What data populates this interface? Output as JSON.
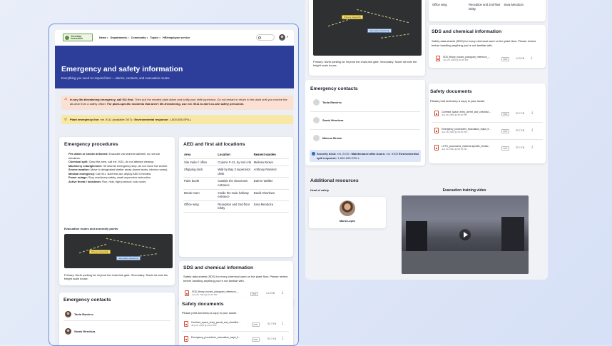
{
  "app": {
    "logo_text": "Vendzlay Industries",
    "nav": [
      "News",
      "Departments",
      "Community",
      "Topics",
      "HR/employee service"
    ],
    "search_placeholder": ""
  },
  "hero": {
    "title": "Emergency and safety information",
    "subtitle": "Everything you need to respond fast — alarms, contacts, and evacuation routes."
  },
  "alert": {
    "lead": "In any life-threatening emergency, call 911 first.",
    "body": "Then pull the nearest plant alarm and notify your shift supervisor. Do not restart or return to the plant until you receive the all-clear from a safety officer.",
    "bold_tail": "For plant-specific incidents that aren’t life-threatening, use ext. 9311 to alert on-site safety personnel."
  },
  "hotline": {
    "label": "Plant emergency line:",
    "value": "ext. 9111 (available 24/7)",
    "sep": " • ",
    "env_label": "Environmental response:",
    "env_value": "1-800-555-SPILL"
  },
  "procedures": {
    "title": "Emergency procedures",
    "items": [
      {
        "term": "Fire alarm or smoke detected:",
        "text": "Evacuate via nearest stairwell, do not use elevators."
      },
      {
        "term": "Chemical spill:",
        "text": "Clear the area, call ext. 9111, do not attempt cleanup."
      },
      {
        "term": "Machinery entanglement:",
        "text": "Hit nearest emergency stop, do not move the worker."
      },
      {
        "term": "Severe weather:",
        "text": "Move to designated shelter areas (lower levels, interior rooms)."
      },
      {
        "term": "Medical emergency:",
        "text": "Call 911, start first aid, deploy AED if needed."
      },
      {
        "term": "Power outage:",
        "text": "Stop machinery safely, await supervisor instruction."
      },
      {
        "term": "Active threat / lockdown:",
        "text": "Run, hide, fight protocol; lock doors."
      }
    ],
    "routes_title": "Evacuation routes and assembly points",
    "map_labels": {
      "primary": "Primary Assembly",
      "secondary": "Secondary Assembly"
    },
    "caption": "Primary: North parking lot, beyond the chain-link gate. Secondary: South lot near the freight scale house."
  },
  "aed": {
    "title": "AED and first aid locations",
    "columns": [
      "Area",
      "Location",
      "Nearest warden"
    ],
    "rows": [
      [
        "Site trailer / office",
        "Column F-12, by tool crib",
        "Melissa Brown"
      ],
      [
        "Shipping dock",
        "Wall by Bay 3 supervisor desk",
        "Anthony Ramirez"
      ],
      [
        "Paint booth",
        "Outside the cleanroom entrance",
        "Darren Walker"
      ],
      [
        "Break room",
        "Inside the main hallway entrance",
        "David Okonkwo"
      ],
      [
        "Office wing",
        "Reception and 2nd-floor lobby",
        "Sara Mendoza"
      ]
    ]
  },
  "sds": {
    "title": "SDS and chemical information",
    "text": "Safety data sheets (SDS) for every chemical used on the plant floor. Please review before handling anything you’re not familiar with.",
    "file": {
      "name": "SDS_library_hazard_pictogram_reference_...",
      "date": "July 20, 2024 @ 09:15 PM",
      "type": "PDF",
      "size": "14.3 KB"
    }
  },
  "contacts": {
    "title": "Emergency contacts",
    "people": [
      "Tania Ramirez",
      "Sarah Mendoza",
      "Marcus Brown"
    ]
  },
  "security": {
    "label": "Security desk:",
    "value": "ext. 2100",
    "sep": " • ",
    "maint_label": "Maintenance after-hours:",
    "maint_value": "ext. 9300",
    "env_label": "Environmental spill response:",
    "env_value": "1-800-555-SPILL"
  },
  "documents": {
    "title": "Safety documents",
    "intro": "Please print and keep a copy in your locker.",
    "files": [
      {
        "name": "Confined_space_entry_permit_and_checklist....",
        "date": "July 20, 2024 @ 09:15 PM",
        "type": "PDF",
        "size": "93.7 KB"
      },
      {
        "name": "Emergency_procedures_evacuation_maps_fl...",
        "date": "July 20, 2024 @ 09:15 PM",
        "type": "PDF",
        "size": "93.7 KB"
      },
      {
        "name": "LOTO_procedures_machine-specific_shutdo...",
        "date": "July 20, 2024 @ 09:15 PM",
        "type": "PDF",
        "size": "93.7 KB"
      }
    ]
  },
  "resources": {
    "title": "Additional resources",
    "head_label": "Head of safety",
    "head_name": "Maria Lopez",
    "video_title": "Evacuation training video"
  },
  "colors": {
    "brand": "#2c3e9a",
    "accent_yellow": "#f6e17d",
    "alert_bg": "#fbe1d4",
    "hotline_bg": "#f9e7a6",
    "security_bg": "#dde6f7"
  }
}
